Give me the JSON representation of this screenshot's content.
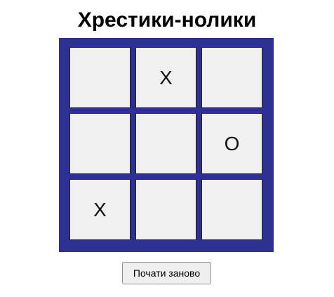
{
  "title": "Хрестики-нолики",
  "board": {
    "cells": [
      "",
      "X",
      "",
      "",
      "",
      "O",
      "X",
      "",
      ""
    ]
  },
  "restart_label": "Почати заново",
  "colors": {
    "board_border": "#2e3192",
    "cell_bg": "#f0f0f0"
  }
}
